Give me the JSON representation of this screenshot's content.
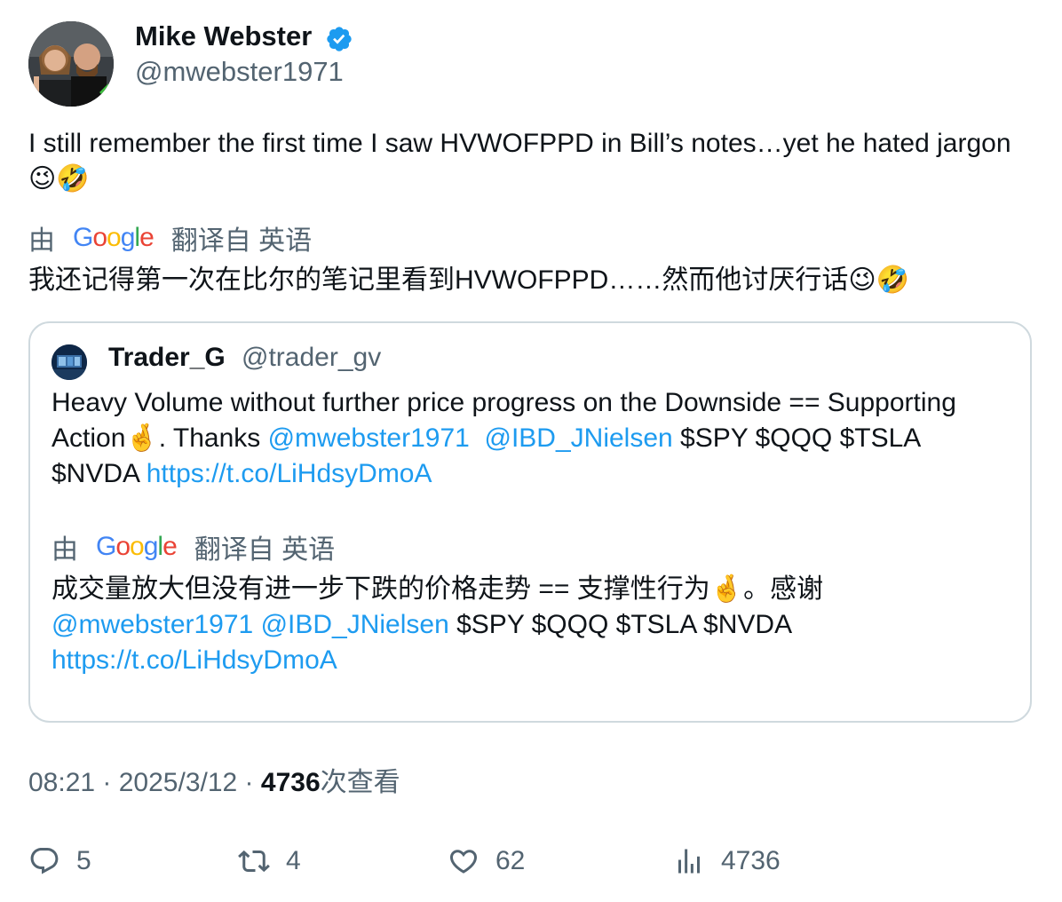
{
  "author": {
    "name": "Mike Webster",
    "handle": "@mwebster1971",
    "verified_icon": "verified-badge-icon",
    "badge_color": "#1d9bf0"
  },
  "tweet": {
    "text": "I still remember the first time I saw HVWOFPPD in Bill’s notes…yet he hated jargon",
    "emojis": "😉🤣"
  },
  "translation": {
    "prefix": "由",
    "provider": "Google",
    "suffix": "翻译自 英语",
    "text": "我还记得第一次在比尔的笔记里看到HVWOFPPD……然而他讨厌行话",
    "emojis": "😉🤣"
  },
  "quote": {
    "name": "Trader_G",
    "handle": "@trader_gv",
    "text_part1": "Heavy Volume without further price progress on the Downside == Supporting Action",
    "text_emoji": "🤞",
    "text_part2": ".  Thanks ",
    "mention1": "@mwebster1971",
    "mention2": "@IBD_JNielsen",
    "tickers": " $SPY $QQQ $TSLA $NVDA ",
    "link": "https://t.co/LiHdsyDmoA",
    "translation": {
      "prefix": "由",
      "provider": "Google",
      "suffix": "翻译自 英语",
      "text_part1": "成交量放大但没有进一步下跌的价格走势 == 支撑性行为",
      "text_emoji": "🤞",
      "text_part2": "。感谢",
      "mention1": "@mwebster1971",
      "mention2": "@IBD_JNielsen",
      "tickers": " $SPY $QQQ $TSLA $NVDA",
      "link": "https://t.co/LiHdsyDmoA"
    }
  },
  "meta": {
    "time": "08:21",
    "sep": " · ",
    "date": "2025/3/12",
    "views_count": "4736",
    "views_label": "次查看"
  },
  "actions": {
    "replies": "5",
    "retweets": "4",
    "likes": "62",
    "views": "4736"
  },
  "colors": {
    "link": "#1d9bf0",
    "secondary_text": "#536471",
    "primary_text": "#0f1419",
    "border": "#cfd9de"
  }
}
